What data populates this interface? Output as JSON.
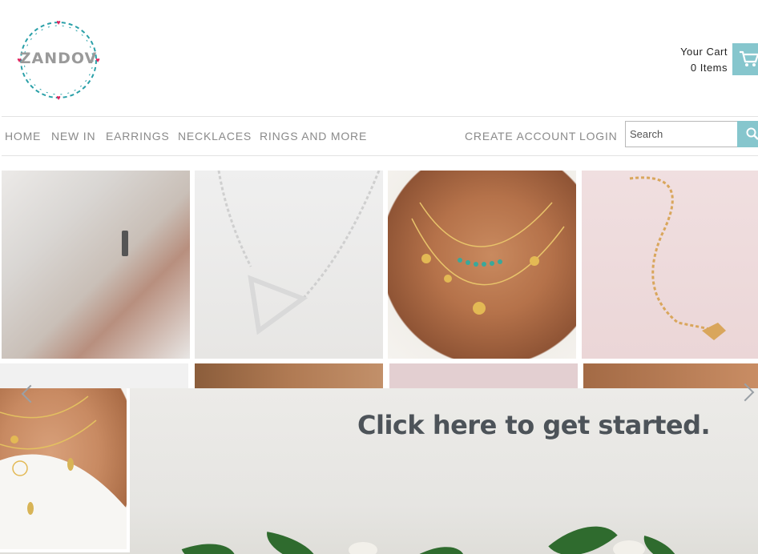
{
  "brand": {
    "name": "ZANDOV",
    "accent": "#86c6cd",
    "wreath_color": "#2aa0a8",
    "heart_color": "#e0245e"
  },
  "cart": {
    "label": "Your Cart",
    "items": "0 Items",
    "icon": "cart-icon"
  },
  "nav": {
    "left": [
      "HOME",
      "NEW IN",
      "EARRINGS",
      "NECKLACES",
      "RINGS AND MORE"
    ],
    "create_account": "CREATE ACCOUNT",
    "login": "LOGIN"
  },
  "search": {
    "placeholder": "Search",
    "icon": "search-icon"
  },
  "banner": {
    "text": "Click here to get started."
  },
  "carousel": {
    "prev_icon": "chevron-left-icon",
    "next_icon": "chevron-right-icon"
  }
}
